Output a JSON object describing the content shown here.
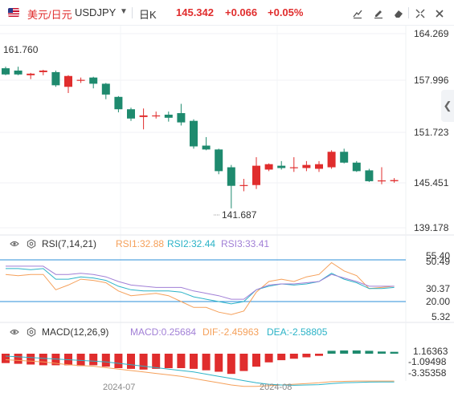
{
  "header": {
    "symbol_cn": "美元/日元",
    "symbol_code": "USDJPY",
    "dropdown_glyph": "▼",
    "period": "日K",
    "price": "145.342",
    "change": "+0.066",
    "change_pct": "+0.05%",
    "tools": [
      "draw-icon",
      "pencil-icon",
      "eraser-icon",
      "expand-icon",
      "close-icon"
    ],
    "up_color": "#e02d2d",
    "down_color": "#1e8a6e"
  },
  "price_axis": {
    "ticks": [
      "164.269",
      "157.996",
      "151.723",
      "145.451",
      "139.178"
    ],
    "high_label": "161.760",
    "low_label": "141.687"
  },
  "rsi": {
    "title": "RSI(7,14,21)",
    "rsi1_label": "RSI1:32.88",
    "rsi2_label": "RSI2:32.44",
    "rsi3_label": "RSI3:33.41",
    "colors": {
      "rsi1": "#f5a05a",
      "rsi2": "#2bb3c7",
      "rsi3": "#a17fd6"
    },
    "ticks": [
      "55.40",
      "50.49",
      "30.37",
      "20.00",
      "5.32"
    ]
  },
  "macd": {
    "title": "MACD(12,26,9)",
    "macd_label": "MACD:0.25684",
    "dif_label": "DIF:-2.45963",
    "dea_label": "DEA:-2.58805",
    "colors": {
      "macd": "#a17fd6",
      "dif": "#f5a05a",
      "dea": "#2bb3c7"
    },
    "ticks": [
      "1.16363",
      "-1.09498",
      "-3.35358"
    ]
  },
  "dates": [
    "2024-07",
    "2024-08"
  ],
  "chart_data": [
    {
      "type": "candlestick",
      "title": "",
      "ylim": [
        139.178,
        164.269
      ],
      "candles": [
        {
          "o": 159.8,
          "h": 160.0,
          "l": 158.9,
          "c": 159.0
        },
        {
          "o": 159.5,
          "h": 160.0,
          "l": 158.9,
          "c": 159.0
        },
        {
          "o": 158.9,
          "h": 159.2,
          "l": 158.4,
          "c": 159.1
        },
        {
          "o": 159.3,
          "h": 159.6,
          "l": 158.9,
          "c": 159.5
        },
        {
          "o": 159.3,
          "h": 159.5,
          "l": 157.4,
          "c": 157.6
        },
        {
          "o": 157.4,
          "h": 158.9,
          "l": 156.6,
          "c": 158.8
        },
        {
          "o": 158.2,
          "h": 158.6,
          "l": 157.9,
          "c": 158.3
        },
        {
          "o": 158.6,
          "h": 158.7,
          "l": 157.2,
          "c": 157.8
        },
        {
          "o": 157.8,
          "h": 157.9,
          "l": 155.8,
          "c": 156.4
        },
        {
          "o": 156.1,
          "h": 156.2,
          "l": 154.1,
          "c": 154.5
        },
        {
          "o": 154.5,
          "h": 154.7,
          "l": 153.0,
          "c": 153.3
        },
        {
          "o": 153.5,
          "h": 154.6,
          "l": 151.9,
          "c": 153.7
        },
        {
          "o": 153.6,
          "h": 154.2,
          "l": 153.3,
          "c": 153.7
        },
        {
          "o": 153.8,
          "h": 154.2,
          "l": 152.9,
          "c": 153.4
        },
        {
          "o": 154.0,
          "h": 155.2,
          "l": 152.4,
          "c": 152.8
        },
        {
          "o": 153.0,
          "h": 153.2,
          "l": 149.4,
          "c": 149.7
        },
        {
          "o": 149.8,
          "h": 150.9,
          "l": 149.2,
          "c": 149.3
        },
        {
          "o": 149.3,
          "h": 149.4,
          "l": 146.1,
          "c": 146.5
        },
        {
          "o": 147.0,
          "h": 147.3,
          "l": 141.687,
          "c": 144.6
        },
        {
          "o": 144.6,
          "h": 145.5,
          "l": 143.9,
          "c": 144.7
        },
        {
          "o": 144.7,
          "h": 148.3,
          "l": 144.2,
          "c": 147.2
        },
        {
          "o": 146.7,
          "h": 147.5,
          "l": 146.5,
          "c": 147.4
        },
        {
          "o": 147.2,
          "h": 147.8,
          "l": 146.7,
          "c": 146.9
        },
        {
          "o": 147.0,
          "h": 148.3,
          "l": 146.4,
          "c": 147.0
        },
        {
          "o": 146.9,
          "h": 147.8,
          "l": 146.5,
          "c": 147.3
        },
        {
          "o": 146.8,
          "h": 147.8,
          "l": 146.4,
          "c": 147.4
        },
        {
          "o": 147.0,
          "h": 149.2,
          "l": 146.8,
          "c": 149.0
        },
        {
          "o": 149.0,
          "h": 149.4,
          "l": 147.5,
          "c": 147.6
        },
        {
          "o": 147.6,
          "h": 147.8,
          "l": 146.4,
          "c": 146.5
        },
        {
          "o": 146.6,
          "h": 146.8,
          "l": 145.1,
          "c": 145.2
        },
        {
          "o": 145.2,
          "h": 147.0,
          "l": 144.8,
          "c": 145.3
        },
        {
          "o": 145.2,
          "h": 145.6,
          "l": 145.0,
          "c": 145.342
        }
      ]
    },
    {
      "type": "line",
      "title": "",
      "ylim": [
        5.32,
        55.4
      ],
      "reference_lines": [
        55.4,
        20.0
      ],
      "series": [
        {
          "name": "RSI1",
          "values": [
            43,
            42,
            43,
            43,
            30,
            34,
            39,
            38,
            36,
            29,
            25,
            26,
            27,
            25,
            20,
            15,
            15,
            11,
            9,
            12,
            28,
            37,
            39,
            37,
            41,
            43,
            53,
            46,
            42,
            31,
            32,
            33
          ]
        },
        {
          "name": "RSI2",
          "values": [
            48,
            48,
            47,
            48,
            39,
            39,
            41,
            40,
            38,
            33,
            30,
            29,
            29,
            29,
            28,
            24,
            22,
            20,
            18,
            20,
            30,
            33,
            35,
            34,
            35,
            37,
            44,
            39,
            36,
            31,
            31,
            32
          ]
        },
        {
          "name": "RSI3",
          "values": [
            50,
            50,
            50,
            50,
            43,
            43,
            44,
            43,
            41,
            37,
            34,
            33,
            32,
            32,
            32,
            29,
            27,
            25,
            22,
            22,
            30,
            34,
            35,
            35,
            36,
            37,
            43,
            40,
            37,
            33,
            33,
            33
          ]
        }
      ]
    },
    {
      "type": "bar",
      "title": "",
      "ylim": [
        -3.6,
        1.35
      ],
      "series": [
        {
          "name": "MACD",
          "values": [
            -1.3,
            -1.4,
            -1.5,
            -1.6,
            -1.6,
            -1.6,
            -1.7,
            -1.6,
            -1.8,
            -2.0,
            -2.1,
            -2.2,
            -2.1,
            -2.0,
            -2.0,
            -2.1,
            -2.3,
            -2.5,
            -2.8,
            -2.4,
            -1.8,
            -1.2,
            -0.9,
            -0.7,
            -0.5,
            -0.3,
            0.4,
            0.45,
            0.45,
            0.4,
            0.3,
            0.26
          ]
        },
        {
          "name": "DIF",
          "values": [
            0.5,
            0.4,
            0.3,
            0.2,
            0.0,
            -0.2,
            -0.3,
            -0.4,
            -0.6,
            -0.8,
            -1.0,
            -1.2,
            -1.4,
            -1.6,
            -1.8,
            -2.1,
            -2.4,
            -2.7,
            -3.0,
            -3.2,
            -3.2,
            -3.1,
            -3.0,
            -2.9,
            -2.8,
            -2.7,
            -2.55,
            -2.5,
            -2.45,
            -2.45,
            -2.46,
            -2.46
          ]
        },
        {
          "name": "DEA",
          "values": [
            1.0,
            0.9,
            0.8,
            0.7,
            0.6,
            0.5,
            0.4,
            0.3,
            0.2,
            0.0,
            -0.2,
            -0.4,
            -0.6,
            -0.8,
            -1.0,
            -1.2,
            -1.5,
            -1.8,
            -2.1,
            -2.4,
            -2.7,
            -2.9,
            -3.0,
            -3.05,
            -3.0,
            -2.95,
            -2.8,
            -2.7,
            -2.65,
            -2.6,
            -2.59,
            -2.59
          ]
        }
      ]
    }
  ]
}
